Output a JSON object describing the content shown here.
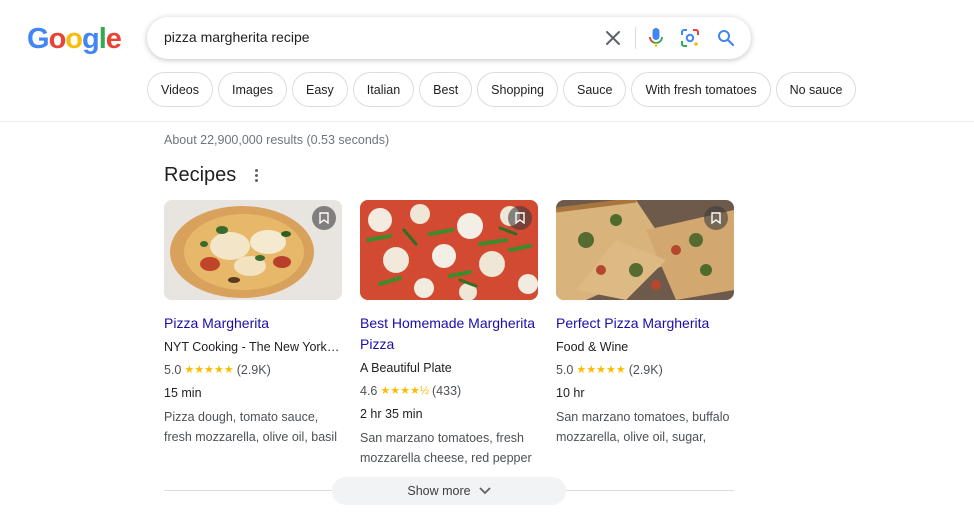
{
  "logo": {
    "letters": [
      "G",
      "o",
      "o",
      "g",
      "l",
      "e"
    ],
    "colors": [
      "#4285F4",
      "#EA4335",
      "#FBBC05",
      "#4285F4",
      "#34A853",
      "#EA4335"
    ]
  },
  "search": {
    "query": "pizza margherita recipe",
    "icons": [
      "close-icon",
      "microphone-icon",
      "lens-icon",
      "search-icon"
    ]
  },
  "chips": [
    "Videos",
    "Images",
    "Easy",
    "Italian",
    "Best",
    "Shopping",
    "Sauce",
    "With fresh tomatoes",
    "No sauce"
  ],
  "result_stats": "About 22,900,000 results (0.53 seconds)",
  "recipes": {
    "title": "Recipes",
    "cards": [
      {
        "title": "Pizza Margherita",
        "source": "NYT Cooking - The New York Times",
        "rating": "5.0",
        "stars": "★★★★★",
        "reviews": "(2.9K)",
        "time": "15 min",
        "ingredients": "Pizza dough, tomato sauce, fresh mozzarella, olive oil, basil"
      },
      {
        "title": "Best Homemade Margherita Pizza",
        "source": "A Beautiful Plate",
        "rating": "4.6",
        "stars": "★★★★½",
        "reviews": "(433)",
        "time": "2 hr 35 min",
        "ingredients": "San marzano tomatoes, fresh mozzarella cheese, red pepper"
      },
      {
        "title": "Perfect Pizza Margherita",
        "source": "Food & Wine",
        "rating": "5.0",
        "stars": "★★★★★",
        "reviews": "(2.9K)",
        "time": "10 hr",
        "ingredients": "San marzano tomatoes, buffalo mozzarella, olive oil, sugar,"
      }
    ]
  },
  "show_more": "Show more",
  "colors": {
    "link": "#1a0dab",
    "star": "#fbbc04",
    "chip_border": "#dadce0"
  }
}
